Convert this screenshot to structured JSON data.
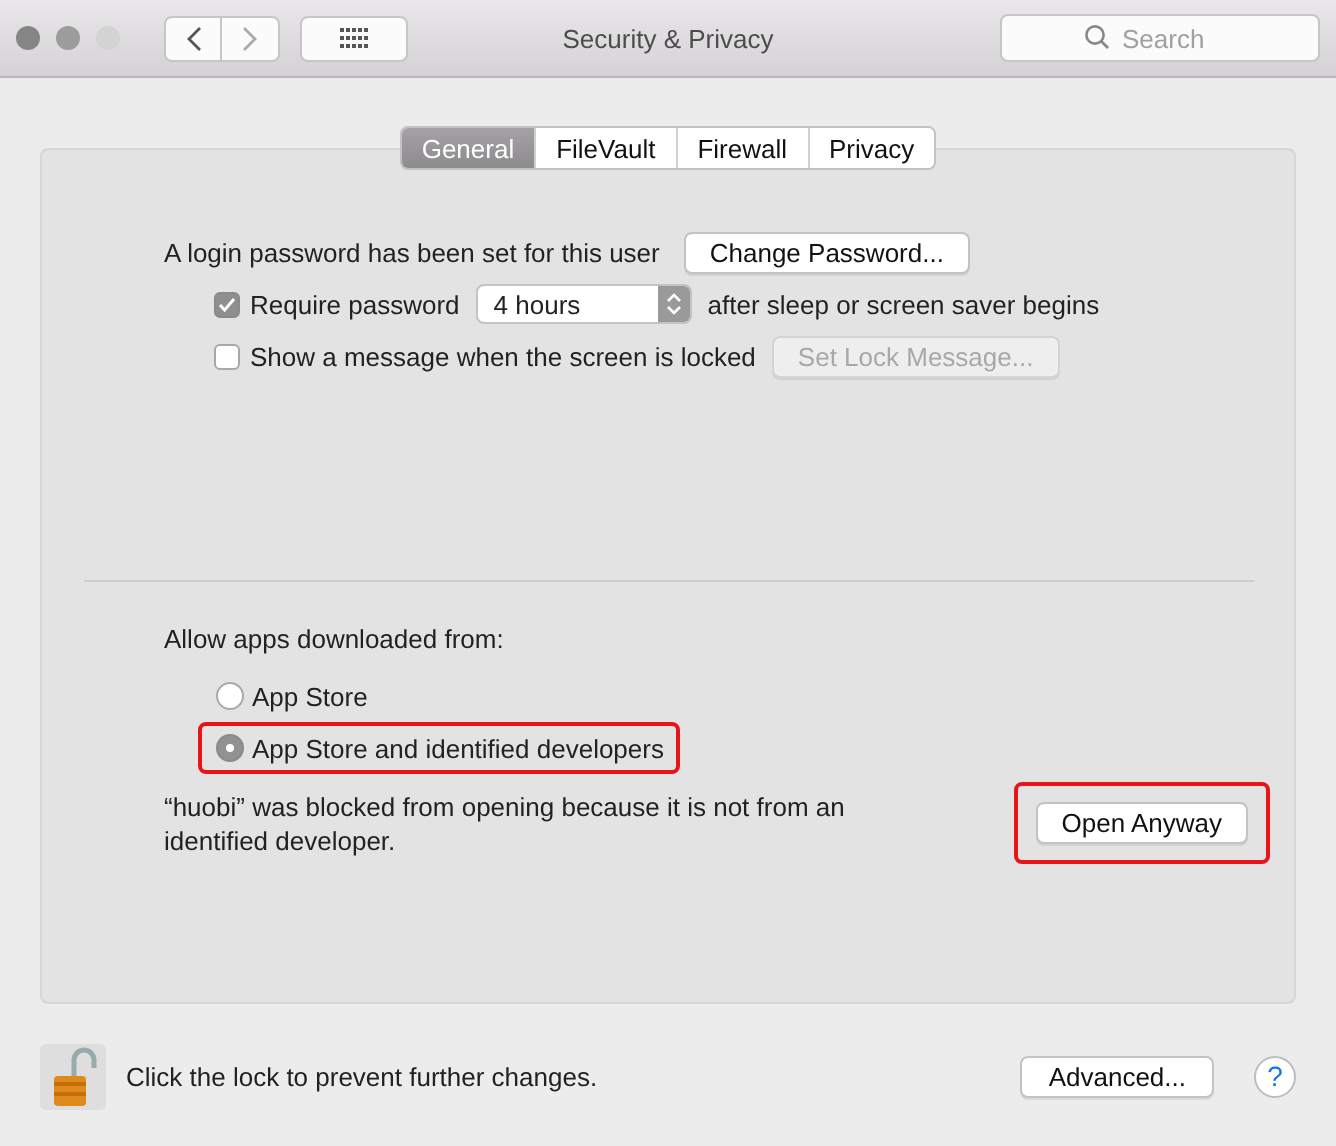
{
  "window": {
    "title": "Security & Privacy",
    "search": {
      "placeholder": "Search"
    }
  },
  "tabs": [
    {
      "label": "General",
      "selected": true
    },
    {
      "label": "FileVault",
      "selected": false
    },
    {
      "label": "Firewall",
      "selected": false
    },
    {
      "label": "Privacy",
      "selected": false
    }
  ],
  "login": {
    "text": "A login password has been set for this user",
    "button": "Change Password..."
  },
  "require_password": {
    "checked": true,
    "label": "Require password",
    "value": "4 hours",
    "suffix": "after sleep or screen saver begins"
  },
  "lock_message": {
    "checked": false,
    "label": "Show a message when the screen is locked",
    "button": "Set Lock Message...",
    "button_disabled": true
  },
  "allow": {
    "label": "Allow apps downloaded from:",
    "options": [
      {
        "label": "App Store",
        "selected": false,
        "highlighted": false
      },
      {
        "label": "App Store and identified developers",
        "selected": true,
        "highlighted": true
      }
    ]
  },
  "blocked": {
    "text": "“huobi” was blocked from opening because it is not from an identified developer.",
    "button": "Open Anyway",
    "highlighted": true
  },
  "footer": {
    "locked": false,
    "text": "Click the lock to prevent further changes.",
    "button": "Advanced...",
    "help": "?"
  }
}
